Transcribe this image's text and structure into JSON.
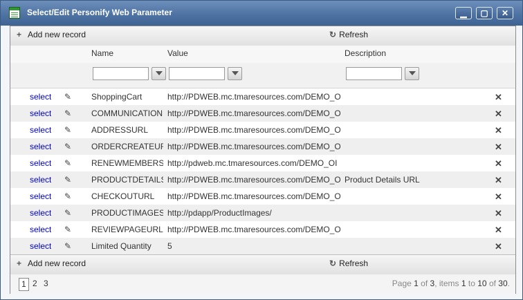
{
  "window": {
    "title": "Select/Edit Personify Web Parameter",
    "minimize": "▁",
    "maximize": "▢",
    "close": "✕"
  },
  "toolbar": {
    "add_label": "Add new record",
    "refresh_label": "Refresh"
  },
  "columns": {
    "name": "Name",
    "value": "Value",
    "description": "Description"
  },
  "rows": [
    {
      "action": "select",
      "name": "ShoppingCart",
      "value": "http://PDWEB.mc.tmaresources.com/DEMO_O",
      "description": ""
    },
    {
      "action": "select",
      "name": "COMMUNICATION",
      "value": "http://PDWEB.mc.tmaresources.com/DEMO_O",
      "description": ""
    },
    {
      "action": "select",
      "name": "ADDRESSURL",
      "value": "http://PDWEB.mc.tmaresources.com/DEMO_O",
      "description": ""
    },
    {
      "action": "select",
      "name": "ORDERCREATEURL",
      "value": "http://PDWEB.mc.tmaresources.com/DEMO_O",
      "description": ""
    },
    {
      "action": "select",
      "name": "RENEWMEMBERSHI",
      "value": "http://pdweb.mc.tmaresources.com/DEMO_OI",
      "description": ""
    },
    {
      "action": "select",
      "name": "PRODUCTDETAILS",
      "value": "http://PDWEB.mc.tmaresources.com/DEMO_O",
      "description": "Product Details URL"
    },
    {
      "action": "select",
      "name": "CHECKOUTURL",
      "value": "http://PDWEB.mc.tmaresources.com/DEMO_O",
      "description": ""
    },
    {
      "action": "select",
      "name": "PRODUCTIMAGES",
      "value": "http://pdapp/ProductImages/",
      "description": ""
    },
    {
      "action": "select",
      "name": "REVIEWPAGEURL",
      "value": "http://PDWEB.mc.tmaresources.com/DEMO_O",
      "description": ""
    },
    {
      "action": "select",
      "name": "Limited Quantity",
      "value": "5",
      "description": ""
    }
  ],
  "pager": {
    "pages": [
      "1",
      "2",
      "3"
    ],
    "current": "1",
    "info_prefix": "Page ",
    "page": "1",
    "of_label": " of ",
    "total_pages": "3",
    "items_label": ", items ",
    "from": "1",
    "to_label": " to ",
    "to": "10",
    "of2_label": " of ",
    "total_items": "30",
    "suffix": "."
  }
}
